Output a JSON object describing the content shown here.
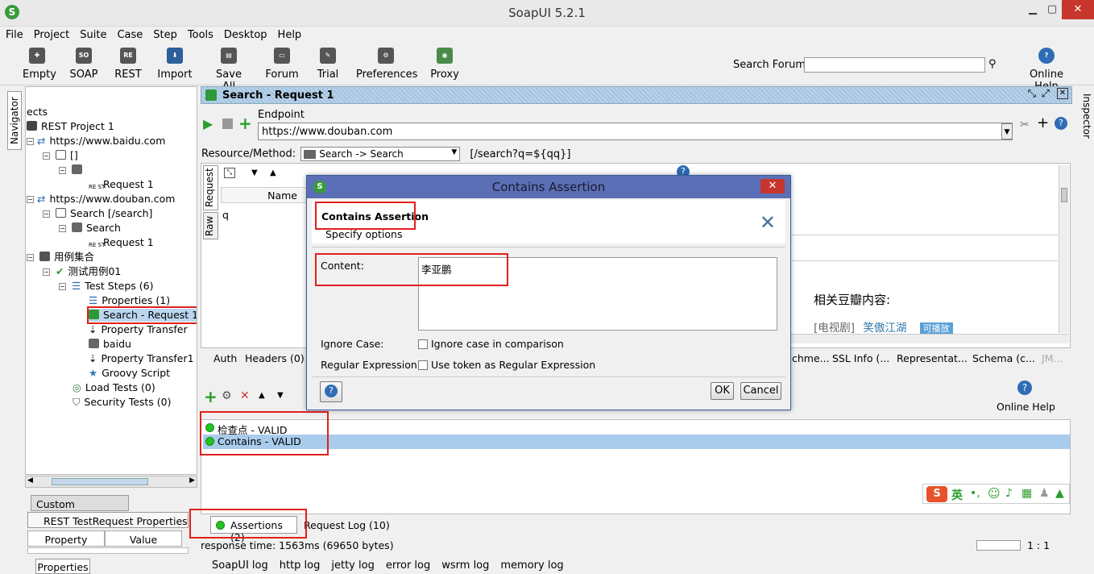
{
  "window": {
    "title": "SoapUI 5.2.1"
  },
  "menu": [
    "File",
    "Project",
    "Suite",
    "Case",
    "Step",
    "Tools",
    "Desktop",
    "Help"
  ],
  "toolbar": {
    "items": [
      "Empty",
      "SOAP",
      "REST",
      "Import",
      "Save All",
      "Forum",
      "Trial",
      "Preferences",
      "Proxy"
    ],
    "search_label": "Search Forum",
    "search_value": "",
    "help_label": "Online Help"
  },
  "side": {
    "navigator": "Navigator",
    "inspector": "Inspector"
  },
  "tree": {
    "root": "ects",
    "nodes": [
      "REST Project 1",
      "https://www.baidu.com",
      "[]",
      "Request 1",
      "https://www.douban.com",
      "Search [/search]",
      "Search",
      "Request 1",
      "用例集合",
      "测试用例01",
      "Test Steps (6)",
      "Properties (1)",
      "Search - Request 1",
      "Property Transfer",
      "baidu",
      "Property Transfer1",
      "Groovy Script",
      "Load Tests (0)",
      "Security Tests (0)"
    ]
  },
  "props": {
    "custom_tab": "Custom Properties",
    "rest_tab": "REST TestRequest Properties",
    "col_property": "Property",
    "col_value": "Value",
    "bottom_tab": "Properties"
  },
  "editor": {
    "title": "Search - Request 1",
    "endpoint_label": "Endpoint",
    "endpoint_value": "https://www.douban.com",
    "resource_label": "Resource/Method:",
    "resource_value": "Search -> Search",
    "resource_path": "[/search?q=${qq}]",
    "request_tab": "Request",
    "raw_tab": "Raw",
    "col_name": "Name",
    "param_q": "q",
    "response_heading": "相关豆瓣内容:",
    "response_line_tag": "[电视剧]",
    "response_line_link": "笑傲江湖",
    "response_line_badge": "可播放",
    "tabs_left": [
      "Auth",
      "Headers (0)"
    ],
    "tabs_right": [
      "chme...",
      "SSL Info (...",
      "Representat...",
      "Schema (c...",
      "JM..."
    ]
  },
  "assertions": {
    "help_label": "Online Help",
    "items": [
      "检查点 - VALID",
      "Contains - VALID"
    ],
    "tab_assertions": "Assertions (2)",
    "tab_request_log": "Request Log (10)",
    "status_text": "response time: 1563ms (69650 bytes)",
    "position": "1 : 1"
  },
  "logs": [
    "SoapUI log",
    "http log",
    "jetty log",
    "error log",
    "wsrm log",
    "memory log"
  ],
  "dialog": {
    "title": "Contains Assertion",
    "heading": "Contains Assertion",
    "subheading": "Specify options",
    "content_label": "Content:",
    "content_value": "李亚鹏",
    "ignore_case_label": "Ignore Case:",
    "ignore_case_text": "Ignore case in comparison",
    "regex_label": "Regular Expression:",
    "regex_text": "Use token as Regular Expression",
    "ok": "OK",
    "cancel": "Cancel"
  },
  "ime": {
    "lang": "英"
  },
  "colors": {
    "accent": "#3399ff",
    "valid": "#22c322",
    "highlight": "#e0201c",
    "dialog_title": "#5a6fb6"
  }
}
